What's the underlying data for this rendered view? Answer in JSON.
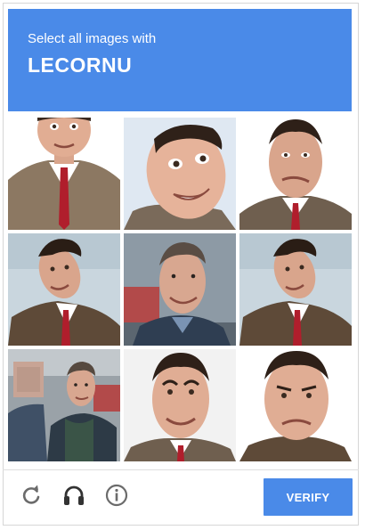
{
  "header": {
    "prompt": "Select all images with",
    "target": "LECORNU",
    "bg_color": "#4a8ae8"
  },
  "grid": {
    "rows": 3,
    "cols": 3,
    "tiles": [
      {
        "subject": "bean-brown-suit-red-tie",
        "bg": "#ffffff"
      },
      {
        "subject": "bean-grinning-closeup",
        "bg": "#dfe8f2"
      },
      {
        "subject": "bean-grimace-suit",
        "bg": "#ffffff"
      },
      {
        "subject": "bean-tilted-head-suit",
        "bg": "#c9d6de"
      },
      {
        "subject": "lecornu-smiling-outdoor",
        "bg": "#8d9aa5"
      },
      {
        "subject": "bean-tilted-head-suit",
        "bg": "#c9d6de"
      },
      {
        "subject": "lecornu-green-sweater-with-blurred-person",
        "bg": "#9aa2a8"
      },
      {
        "subject": "bean-raised-eyebrows-closeup",
        "bg": "#f2f2f2"
      },
      {
        "subject": "bean-frowning-closeup",
        "bg": "#ffffff"
      }
    ]
  },
  "footer": {
    "reload_icon": "reload-icon",
    "audio_icon": "headphones-icon",
    "info_icon": "info-icon",
    "verify_label": "VERIFY",
    "verify_color": "#4a8ae8"
  }
}
